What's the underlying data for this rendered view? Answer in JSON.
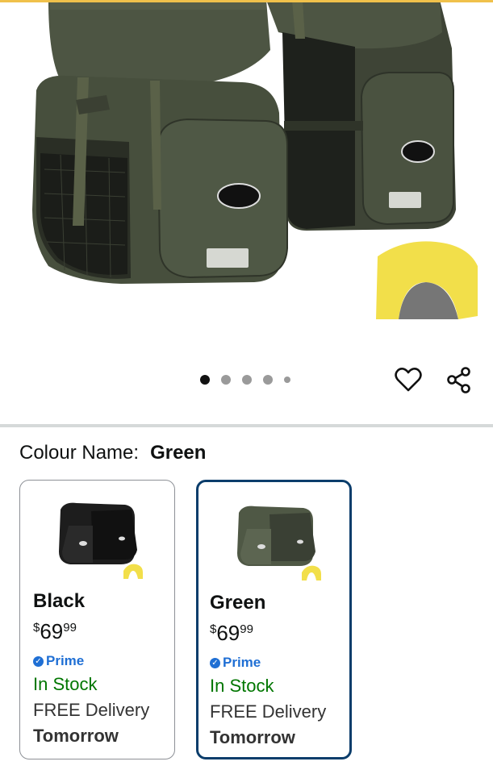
{
  "carousel": {
    "total": 5,
    "active": 0
  },
  "colour": {
    "label": "Colour Name:",
    "selected": "Green"
  },
  "swatches": [
    {
      "name": "Black",
      "price_currency": "$",
      "price_whole": "69",
      "price_cents": "99",
      "prime_label": "Prime",
      "stock": "In Stock",
      "delivery": "FREE Delivery",
      "delivery_day": "Tomorrow",
      "selected": false
    },
    {
      "name": "Green",
      "price_currency": "$",
      "price_whole": "69",
      "price_cents": "99",
      "prime_label": "Prime",
      "stock": "In Stock",
      "delivery": "FREE Delivery",
      "delivery_day": "Tomorrow",
      "selected": true
    }
  ],
  "icons": {
    "wishlist": "heart-icon",
    "share": "share-icon",
    "prime": "prime-check-icon"
  },
  "colors": {
    "selected_border": "#0b3d6b",
    "prime_blue": "#1f6fd4",
    "stock_green": "#007600",
    "bag_green": "#4a5240",
    "rain_cover_yellow": "#f2df4a"
  }
}
